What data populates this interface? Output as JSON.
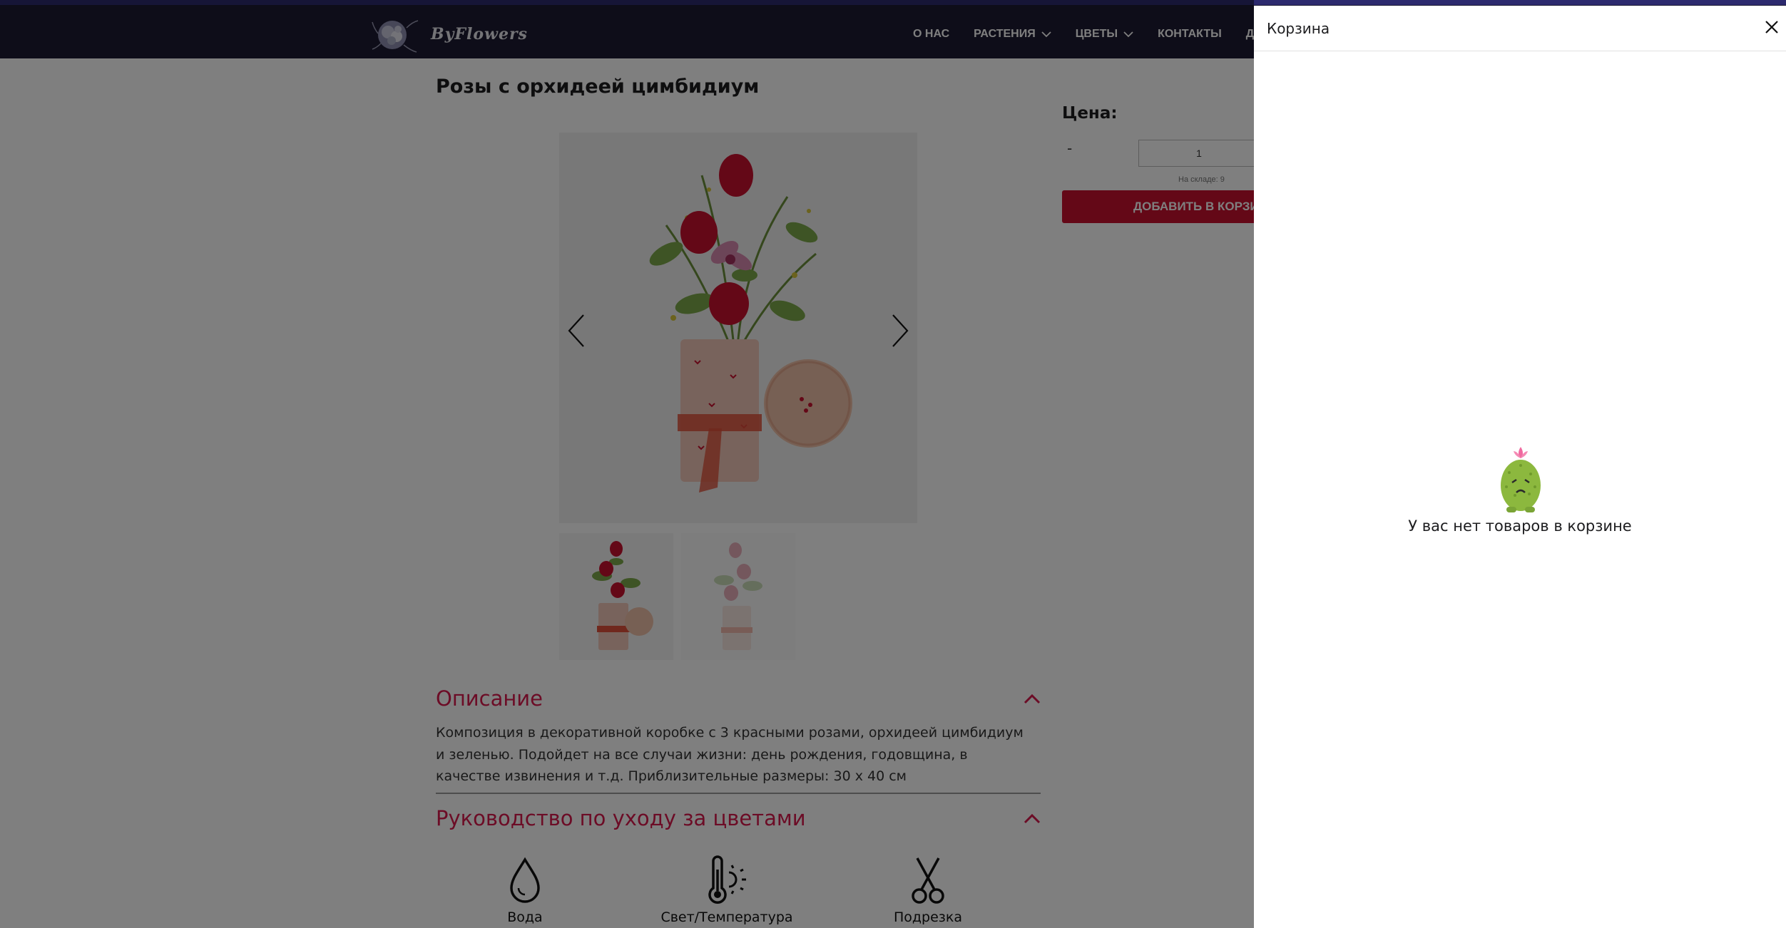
{
  "header": {
    "brand": "ByFlowers",
    "nav": [
      {
        "label": "О НАС",
        "has_dropdown": false
      },
      {
        "label": "РАСТЕНИЯ",
        "has_dropdown": true
      },
      {
        "label": "ЦВЕТЫ",
        "has_dropdown": true
      },
      {
        "label": "КОНТАКТЫ",
        "has_dropdown": false
      },
      {
        "label": "ДО",
        "has_dropdown": false
      }
    ],
    "background": "#1d1b33"
  },
  "product": {
    "title": "Розы с орхидеей цимбидиум",
    "price_label": "Цена:",
    "qty_minus": "-",
    "quantity": "1",
    "stock_text": "На складе: 9",
    "add_to_cart_label": "ДОБАВИТЬ В КОРЗИНУ",
    "accent_color": "#c8102e",
    "thumbnails": [
      {
        "name": "thumbnail-1",
        "active": true
      },
      {
        "name": "thumbnail-2",
        "active": false
      }
    ],
    "description": {
      "heading": "Описание",
      "text": "Композиция в декоративной коробке с 3 красными розами, орхидеей цимбидиум и зеленью. Подойдет на все случаи жизни: день рождения, годовщина, в качестве извинения и т.д. Приблизительные размеры: 30 х 40 см"
    },
    "care": {
      "heading": "Руководство по уходу за цветами",
      "items": [
        {
          "label": "Вода",
          "icon": "water-drop-icon"
        },
        {
          "label": "Свет/Температура",
          "icon": "thermometer-sun-icon"
        },
        {
          "label": "Подрезка",
          "icon": "scissors-icon"
        }
      ]
    },
    "heading_color": "#d9194d"
  },
  "cart": {
    "title": "Корзина",
    "close_icon": "close-icon",
    "empty_icon": "sad-cactus-icon",
    "empty_text": "У вас нет товаров в корзине"
  }
}
